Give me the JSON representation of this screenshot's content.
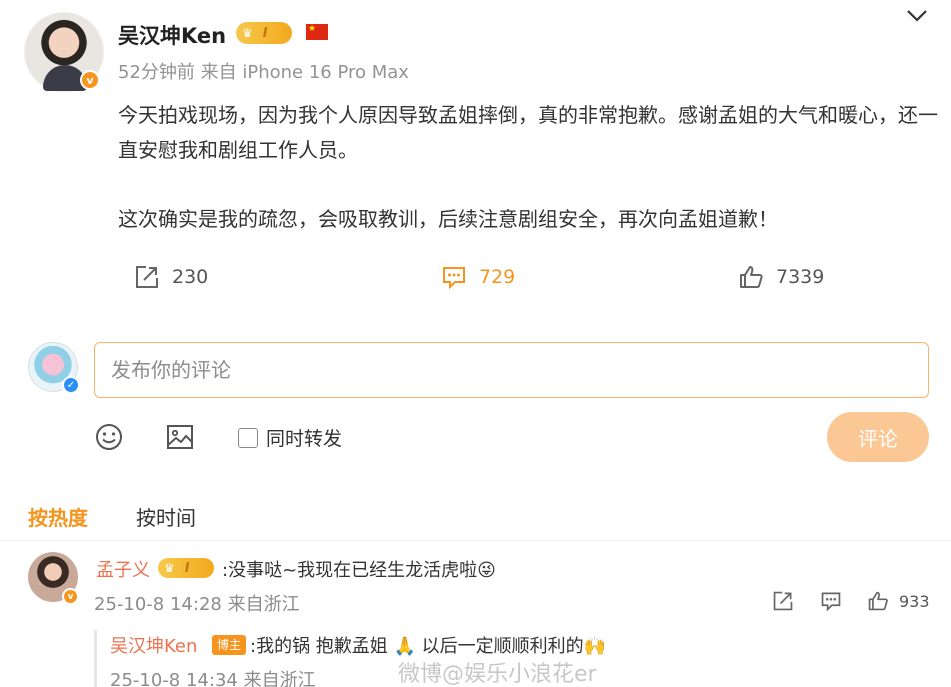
{
  "post": {
    "author_name": "吴汉坤Ken",
    "member_level": "I",
    "meta": "52分钟前 来自 iPhone 16 Pro Max",
    "paragraph_1": "今天拍戏现场，因为我个人原因导致孟姐摔倒，真的非常抱歉。感谢孟姐的大气和暖心，还一直安慰我和剧组工作人员。",
    "paragraph_2": "这次确实是我的疏忽，会吸取教训，后续注意剧组安全，再次向孟姐道歉！",
    "repost_count": "230",
    "comment_count": "729",
    "like_count": "7339"
  },
  "composer": {
    "placeholder": "发布你的评论",
    "repost_label": "同时转发",
    "submit_label": "评论"
  },
  "sort_tabs": {
    "hot": "按热度",
    "time": "按时间"
  },
  "comment": {
    "name": "孟子义",
    "member_level": "I",
    "text": ":没事哒~我现在已经生龙活虎啦😜",
    "meta": "25-10-8 14:28 来自浙江",
    "like_count": "933"
  },
  "reply": {
    "name": "吴汉坤Ken",
    "badge": "博主",
    "text": ":我的锅 抱歉孟姐 🙏 以后一定顺顺利利的🙌",
    "meta": "25-10-8 14:34 来自浙江"
  },
  "watermark": "微博@娱乐小浪花er",
  "colors": {
    "accent": "#f7941d",
    "name_link": "#eb7350",
    "submit_disabled": "#fbc795",
    "flag_red": "#de2910"
  },
  "icons": [
    "crown-icon",
    "china-flag-icon",
    "chevron-down-icon",
    "repost-icon",
    "comment-icon",
    "like-icon",
    "emoji-icon",
    "image-icon",
    "verified-icon"
  ]
}
